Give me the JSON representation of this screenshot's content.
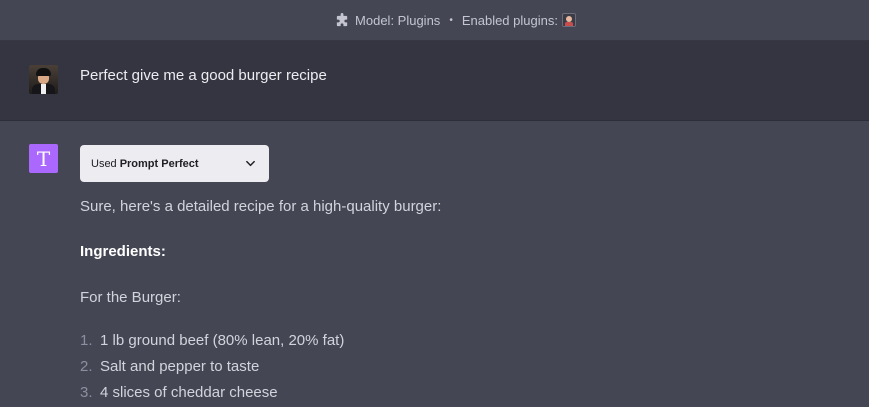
{
  "topbar": {
    "model_label": "Model: Plugins",
    "separator": "•",
    "enabled_label": "Enabled plugins:"
  },
  "user_message": {
    "text": "Perfect give me a good burger recipe"
  },
  "assistant": {
    "avatar_letter": "T",
    "plugin_used": {
      "prefix": "Used",
      "plugin_name": "Prompt Perfect"
    },
    "intro": "Sure, here's a detailed recipe for a high-quality burger:",
    "ingredients_heading": "Ingredients:",
    "burger_subheading": "For the Burger:",
    "items": [
      {
        "num": "1.",
        "text": "1 lb ground beef (80% lean, 20% fat)"
      },
      {
        "num": "2.",
        "text": "Salt and pepper to taste"
      },
      {
        "num": "3.",
        "text": "4 slices of cheddar cheese"
      }
    ]
  },
  "colors": {
    "background": "#444654",
    "user_row": "#343541",
    "bot_avatar": "#ab68ff",
    "plugin_box": "#ececf1"
  }
}
